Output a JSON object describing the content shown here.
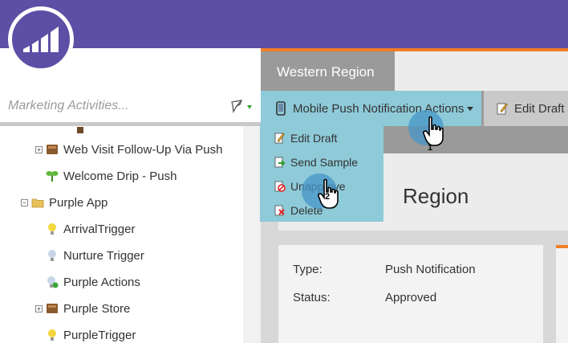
{
  "header": {
    "logo": "marketo-logo"
  },
  "sidebar": {
    "search": {
      "placeholder": "Marketing Activities..."
    },
    "tree": [
      {
        "label": "Web Visit Follow-Up Via Push",
        "icon": "program-icon",
        "expandable": true
      },
      {
        "label": "Welcome Drip - Push",
        "icon": "nurture-icon",
        "expandable": false
      },
      {
        "label": "Purple App",
        "icon": "folder-icon",
        "expandable": true,
        "expanded": true
      },
      {
        "label": "ArrivalTrigger",
        "icon": "bulb-icon",
        "expandable": false
      },
      {
        "label": "Nurture Trigger",
        "icon": "bulb-icon",
        "expandable": false
      },
      {
        "label": "Purple Actions",
        "icon": "smart-campaign-icon",
        "expandable": false
      },
      {
        "label": "Purple Store",
        "icon": "program-icon",
        "expandable": true
      },
      {
        "label": "PurpleTrigger",
        "icon": "bulb-icon",
        "expandable": false
      }
    ]
  },
  "main": {
    "tab": {
      "label": "Western Region"
    },
    "toolbar": {
      "actions_label": "Mobile Push Notification Actions",
      "edit_draft_label": "Edit Draft"
    },
    "dropdown": [
      {
        "label": "Edit Draft",
        "icon": "edit-icon"
      },
      {
        "label": "Send Sample",
        "icon": "send-icon"
      },
      {
        "label": "Unapprove",
        "icon": "unapprove-icon"
      },
      {
        "label": "Delete",
        "icon": "delete-icon"
      }
    ],
    "panel": {
      "title": "Region"
    },
    "info": {
      "type_label": "Type:",
      "type_value": "Push Notification",
      "status_label": "Status:",
      "status_value": "Approved"
    }
  },
  "annotations": {
    "step1": "1",
    "step2": "2"
  },
  "colors": {
    "header": "#5c4fa5",
    "accent": "#f07e26",
    "menu": "#8ecad8"
  }
}
